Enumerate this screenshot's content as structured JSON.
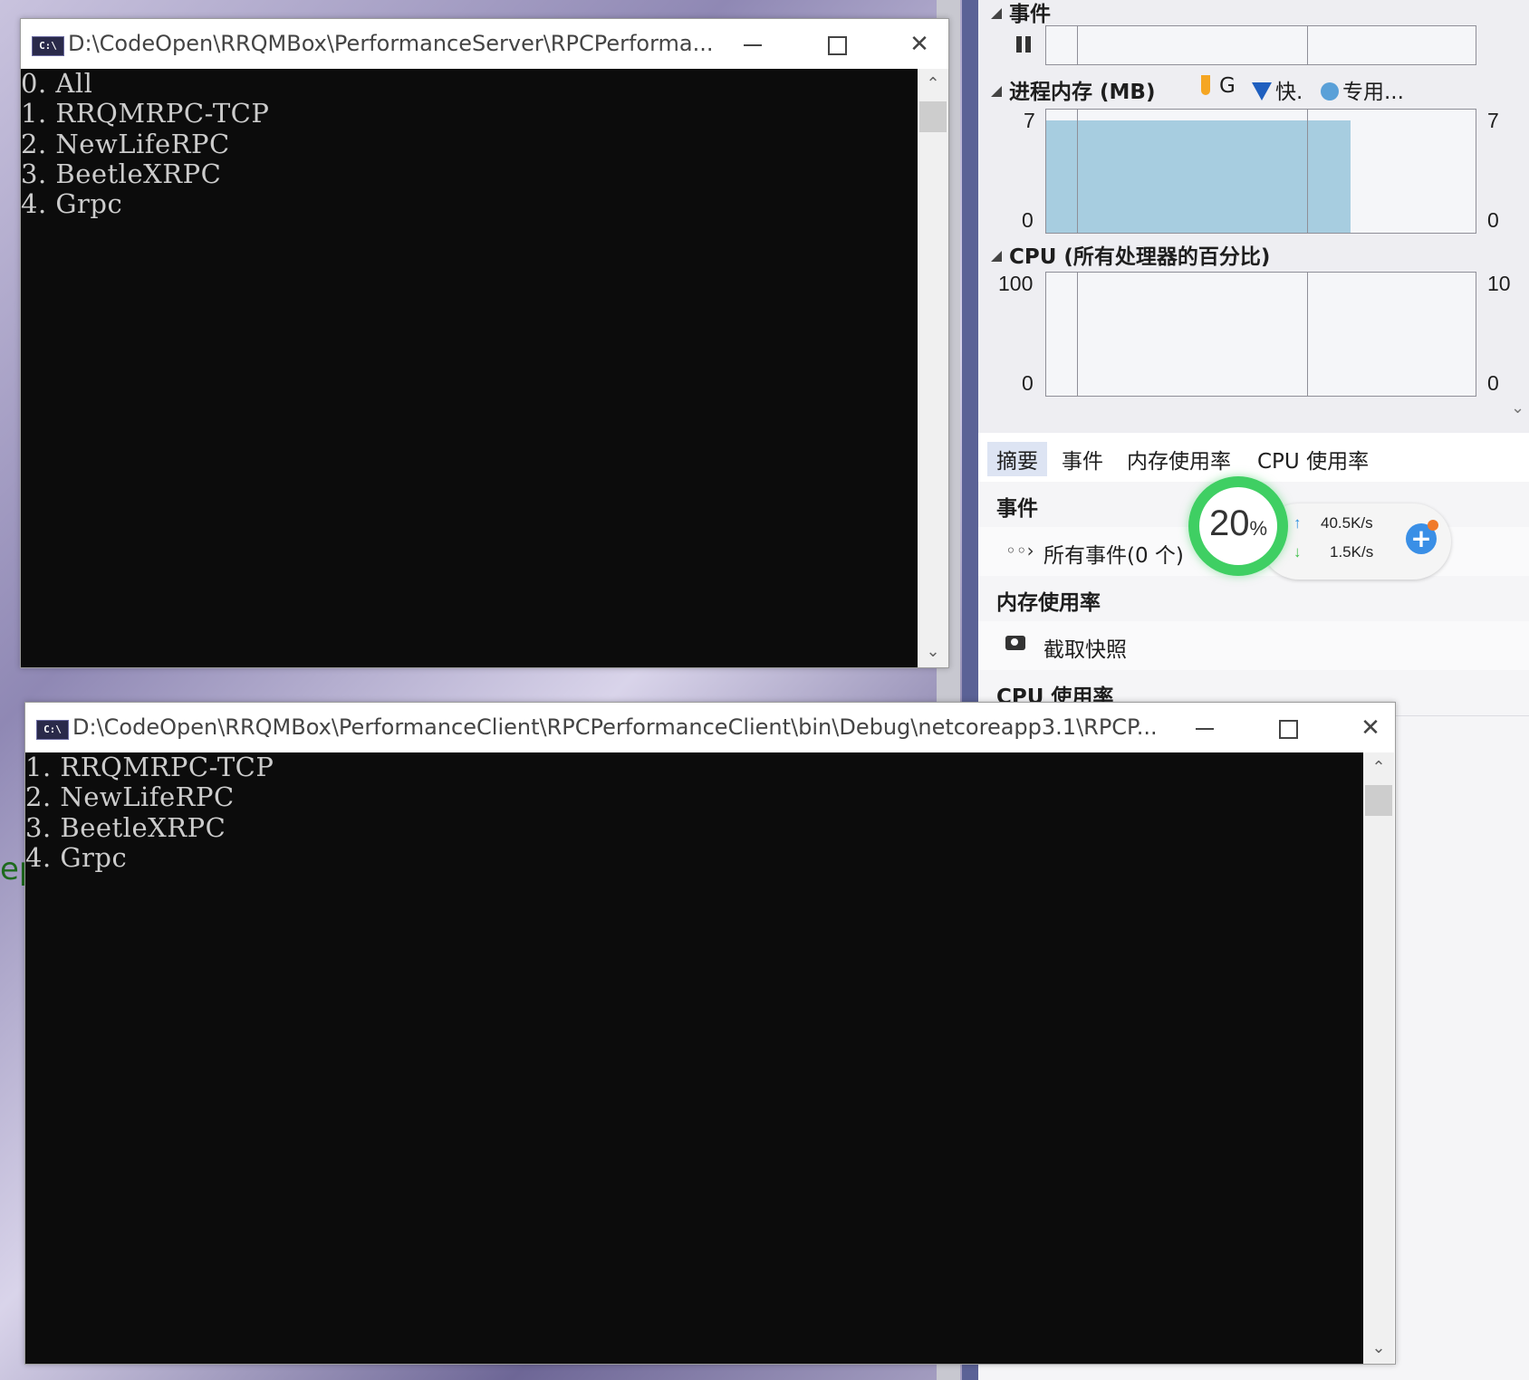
{
  "diagnostics": {
    "events_header": "事件",
    "pause_icon": "pause-icon",
    "memory_header": "进程内存 (MB)",
    "memory_legend": [
      "G",
      "快.",
      "专用..."
    ],
    "memory_legend_colors": [
      "#f5a623",
      "#1f5fbf",
      "#5aa0d8"
    ],
    "memory_fill_color": "#a7cde0",
    "memory_axis": {
      "top_left": "7",
      "bottom_left": "0",
      "top_right": "7",
      "bottom_right": "0"
    },
    "cpu_header": "CPU (所有处理器的百分比)",
    "cpu_axis": {
      "top_left": "100",
      "bottom_left": "0",
      "top_right": "10",
      "bottom_right": "0"
    },
    "tabs": [
      "摘要",
      "事件",
      "内存使用率",
      "CPU 使用率"
    ],
    "summary": {
      "events_title": "事件",
      "all_events": "所有事件(0 个)",
      "memory_title": "内存使用率",
      "snapshot_label": "截取快照",
      "cpu_title": "CPU 使用率"
    }
  },
  "server_window": {
    "title": "D:\\CodeOpen\\RRQMBox\\PerformanceServer\\RPCPerforma...",
    "icon_text": "C:\\",
    "lines": [
      "0. All",
      "1. RRQMRPC-TCP",
      "2. NewLifeRPC",
      "3. BeetleXRPC",
      "4. Grpc"
    ]
  },
  "client_window": {
    "title": "D:\\CodeOpen\\RRQMBox\\PerformanceClient\\RPCPerformanceClient\\bin\\Debug\\netcoreapp3.1\\RPCP...",
    "icon_text": "C:\\",
    "lines": [
      "1. RRQMRPC-TCP",
      "2. NewLifeRPC",
      "3. BeetleXRPC",
      "4. Grpc"
    ]
  },
  "network_widget": {
    "percent": "20",
    "percent_unit": "%",
    "upload": "40.5K/s",
    "download": "1.5K/s",
    "ring_color": "#3fcf63"
  },
  "background_fragment": "ep"
}
